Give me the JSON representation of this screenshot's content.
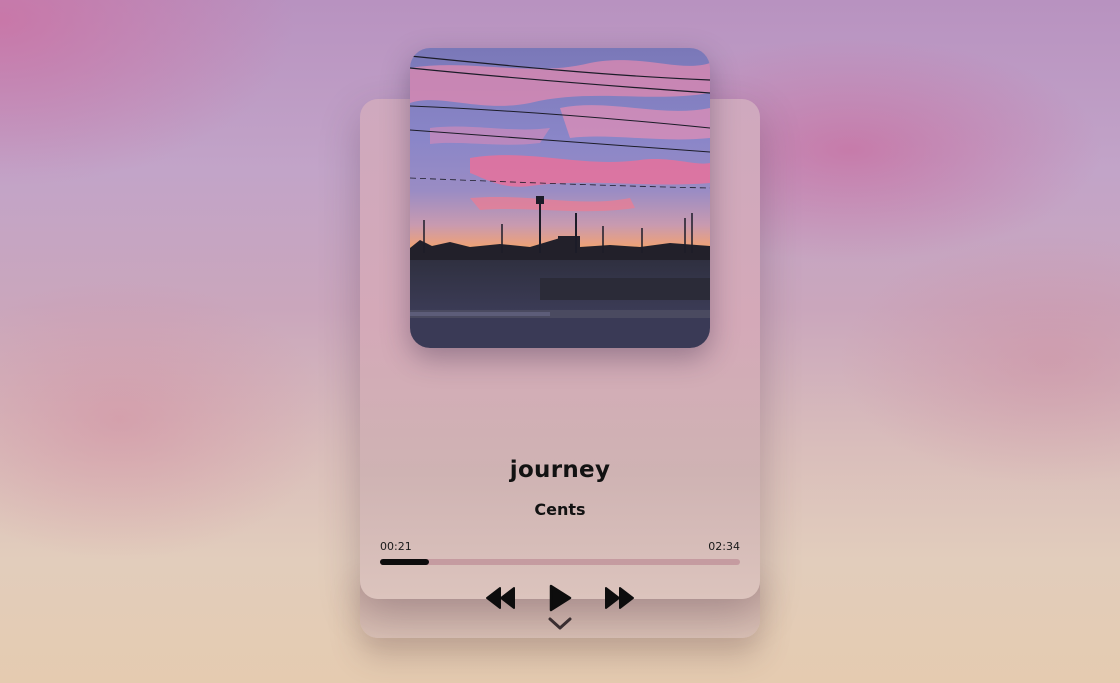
{
  "track": {
    "title": "journey",
    "artist": "Cents"
  },
  "playback": {
    "current_time": "00:21",
    "total_time": "02:34",
    "progress": 0.136
  },
  "icons": {
    "previous": "rewind-icon",
    "play": "play-icon",
    "next": "fast-forward-icon",
    "expand": "chevron-down-icon"
  },
  "colors": {
    "progress_fill": "#0d0d0d",
    "progress_track": "#c08c96",
    "text": "#121212"
  }
}
